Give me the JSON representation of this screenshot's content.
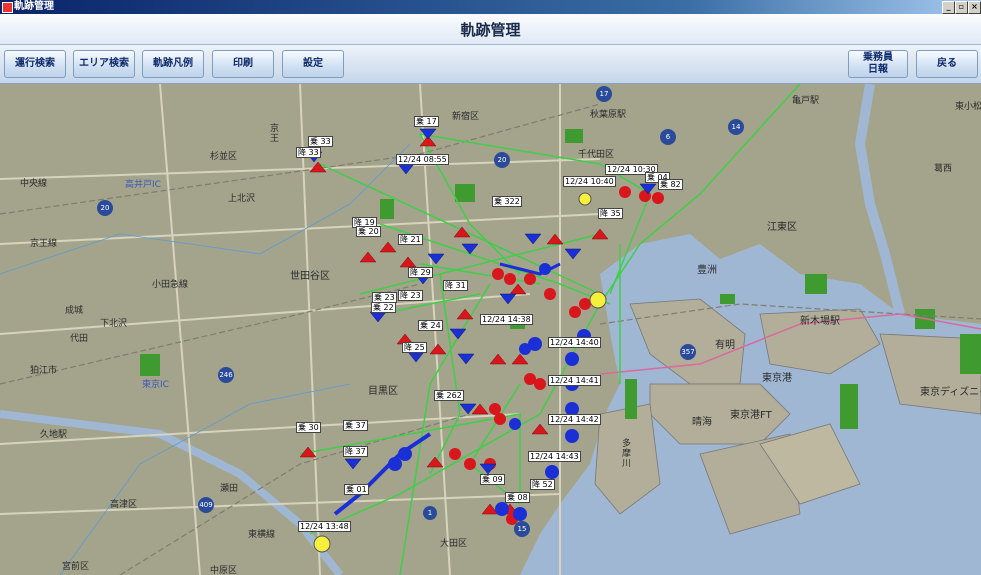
{
  "window": {
    "title": "軌跡管理"
  },
  "header": {
    "title": "軌跡管理"
  },
  "toolbar": {
    "operation_search": "運行検索",
    "area_search": "エリア検索",
    "track_legend": "軌跡凡例",
    "print": "印刷",
    "settings": "設定",
    "crew_daily_report_line1": "乗務員",
    "crew_daily_report_line2": "日報",
    "back": "戻る"
  },
  "map": {
    "places": {
      "shinjuku": "新宿区",
      "suginami": "杉並区",
      "chiyoda": "千代田区",
      "setagaya": "世田谷区",
      "meguro": "目黒区",
      "koto": "江東区",
      "toyosu": "豊洲",
      "ariake": "有明",
      "shinkiba": "新木場駅",
      "tokyo_port": "東京港",
      "tokyo_port_ft": "東京港FT",
      "harumi": "晴海",
      "ota": "大田区",
      "komae": "狛江市",
      "disney": "東京ディズニー",
      "kugahara": "久地駅",
      "takatsu": "高津区",
      "miyamae": "宮前区",
      "nakahara": "中原区",
      "kamata": "東京IC",
      "seijo": "成城",
      "kamikitazawa": "上北沢",
      "seta": "瀬田",
      "akihabara": "秋葉原駅",
      "kameido": "亀戸駅",
      "shimoki": "下北沢",
      "suzukake": "高井戸IC",
      "yokohama_line": "東小松",
      "koutou_ku2": "葛西",
      "chofu_line": "京王線",
      "tama": "多摩川",
      "odakyu": "小田急線",
      "daita": "代田",
      "keio_col": "京王",
      "chuo_col": "中央線",
      "toyoko": "東横線"
    },
    "routes": {
      "r17": "17",
      "r6": "6",
      "r14": "14",
      "r20a": "20",
      "r20b": "20",
      "r246": "246",
      "r357": "357",
      "r15": "15",
      "r409": "409",
      "r1": "1"
    },
    "bubbles": {
      "b1": "乗 17",
      "b2": "乗 33",
      "b3": "降 33",
      "b4": "12/24 08:55",
      "b5": "12/24 10:30",
      "b6": "乗 04",
      "b7": "12/24 10:40",
      "b8": "乗 322",
      "b9": "降 19",
      "b10": "乗 20",
      "b11": "降 21",
      "b12": "降 29",
      "b13": "降 31",
      "b14": "乗 23",
      "b15": "降 23",
      "b16": "乗 22",
      "b17": "乗 24",
      "b18": "降 25",
      "b19": "12/24 14:40",
      "b20": "12/24 14:41",
      "b21": "12/24 14:42",
      "b22": "12/24 14:43",
      "b23": "乗 262",
      "b24": "乗 30",
      "b25": "乗 37",
      "b26": "降 37",
      "b27": "乗 01",
      "b28": "12/24 13:48",
      "b29": "乗 09",
      "b30": "降 52",
      "b31": "乗 08",
      "b32": "12/24 14:38",
      "b33": "乗 82",
      "b34": "降 35"
    }
  },
  "colors": {
    "land": "#a4a38c",
    "water": "#9fb7d3",
    "park": "#3f9b2f",
    "track": "#3fcf46",
    "pickup_marker": "#d8161c",
    "dropoff_marker": "#1b2fd6",
    "current_marker": "#f7f03a"
  }
}
